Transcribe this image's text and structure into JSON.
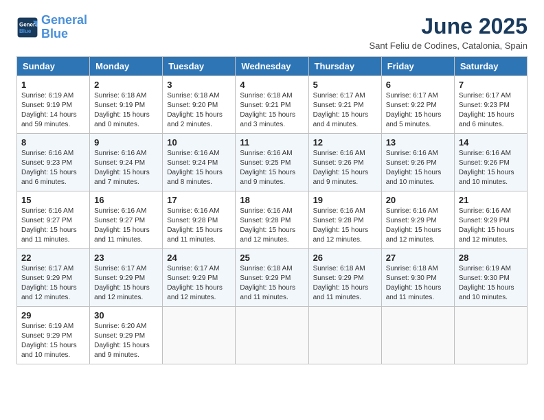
{
  "logo": {
    "line1": "General",
    "line2": "Blue"
  },
  "title": "June 2025",
  "subtitle": "Sant Feliu de Codines, Catalonia, Spain",
  "days_header": [
    "Sunday",
    "Monday",
    "Tuesday",
    "Wednesday",
    "Thursday",
    "Friday",
    "Saturday"
  ],
  "weeks": [
    [
      {
        "day": "1",
        "sunrise": "6:19 AM",
        "sunset": "9:19 PM",
        "daylight": "14 hours and 59 minutes."
      },
      {
        "day": "2",
        "sunrise": "6:18 AM",
        "sunset": "9:19 PM",
        "daylight": "15 hours and 0 minutes."
      },
      {
        "day": "3",
        "sunrise": "6:18 AM",
        "sunset": "9:20 PM",
        "daylight": "15 hours and 2 minutes."
      },
      {
        "day": "4",
        "sunrise": "6:18 AM",
        "sunset": "9:21 PM",
        "daylight": "15 hours and 3 minutes."
      },
      {
        "day": "5",
        "sunrise": "6:17 AM",
        "sunset": "9:21 PM",
        "daylight": "15 hours and 4 minutes."
      },
      {
        "day": "6",
        "sunrise": "6:17 AM",
        "sunset": "9:22 PM",
        "daylight": "15 hours and 5 minutes."
      },
      {
        "day": "7",
        "sunrise": "6:17 AM",
        "sunset": "9:23 PM",
        "daylight": "15 hours and 6 minutes."
      }
    ],
    [
      {
        "day": "8",
        "sunrise": "6:16 AM",
        "sunset": "9:23 PM",
        "daylight": "15 hours and 6 minutes."
      },
      {
        "day": "9",
        "sunrise": "6:16 AM",
        "sunset": "9:24 PM",
        "daylight": "15 hours and 7 minutes."
      },
      {
        "day": "10",
        "sunrise": "6:16 AM",
        "sunset": "9:24 PM",
        "daylight": "15 hours and 8 minutes."
      },
      {
        "day": "11",
        "sunrise": "6:16 AM",
        "sunset": "9:25 PM",
        "daylight": "15 hours and 9 minutes."
      },
      {
        "day": "12",
        "sunrise": "6:16 AM",
        "sunset": "9:26 PM",
        "daylight": "15 hours and 9 minutes."
      },
      {
        "day": "13",
        "sunrise": "6:16 AM",
        "sunset": "9:26 PM",
        "daylight": "15 hours and 10 minutes."
      },
      {
        "day": "14",
        "sunrise": "6:16 AM",
        "sunset": "9:26 PM",
        "daylight": "15 hours and 10 minutes."
      }
    ],
    [
      {
        "day": "15",
        "sunrise": "6:16 AM",
        "sunset": "9:27 PM",
        "daylight": "15 hours and 11 minutes."
      },
      {
        "day": "16",
        "sunrise": "6:16 AM",
        "sunset": "9:27 PM",
        "daylight": "15 hours and 11 minutes."
      },
      {
        "day": "17",
        "sunrise": "6:16 AM",
        "sunset": "9:28 PM",
        "daylight": "15 hours and 11 minutes."
      },
      {
        "day": "18",
        "sunrise": "6:16 AM",
        "sunset": "9:28 PM",
        "daylight": "15 hours and 12 minutes."
      },
      {
        "day": "19",
        "sunrise": "6:16 AM",
        "sunset": "9:28 PM",
        "daylight": "15 hours and 12 minutes."
      },
      {
        "day": "20",
        "sunrise": "6:16 AM",
        "sunset": "9:29 PM",
        "daylight": "15 hours and 12 minutes."
      },
      {
        "day": "21",
        "sunrise": "6:16 AM",
        "sunset": "9:29 PM",
        "daylight": "15 hours and 12 minutes."
      }
    ],
    [
      {
        "day": "22",
        "sunrise": "6:17 AM",
        "sunset": "9:29 PM",
        "daylight": "15 hours and 12 minutes."
      },
      {
        "day": "23",
        "sunrise": "6:17 AM",
        "sunset": "9:29 PM",
        "daylight": "15 hours and 12 minutes."
      },
      {
        "day": "24",
        "sunrise": "6:17 AM",
        "sunset": "9:29 PM",
        "daylight": "15 hours and 12 minutes."
      },
      {
        "day": "25",
        "sunrise": "6:18 AM",
        "sunset": "9:29 PM",
        "daylight": "15 hours and 11 minutes."
      },
      {
        "day": "26",
        "sunrise": "6:18 AM",
        "sunset": "9:29 PM",
        "daylight": "15 hours and 11 minutes."
      },
      {
        "day": "27",
        "sunrise": "6:18 AM",
        "sunset": "9:30 PM",
        "daylight": "15 hours and 11 minutes."
      },
      {
        "day": "28",
        "sunrise": "6:19 AM",
        "sunset": "9:30 PM",
        "daylight": "15 hours and 10 minutes."
      }
    ],
    [
      {
        "day": "29",
        "sunrise": "6:19 AM",
        "sunset": "9:29 PM",
        "daylight": "15 hours and 10 minutes."
      },
      {
        "day": "30",
        "sunrise": "6:20 AM",
        "sunset": "9:29 PM",
        "daylight": "15 hours and 9 minutes."
      },
      null,
      null,
      null,
      null,
      null
    ]
  ]
}
